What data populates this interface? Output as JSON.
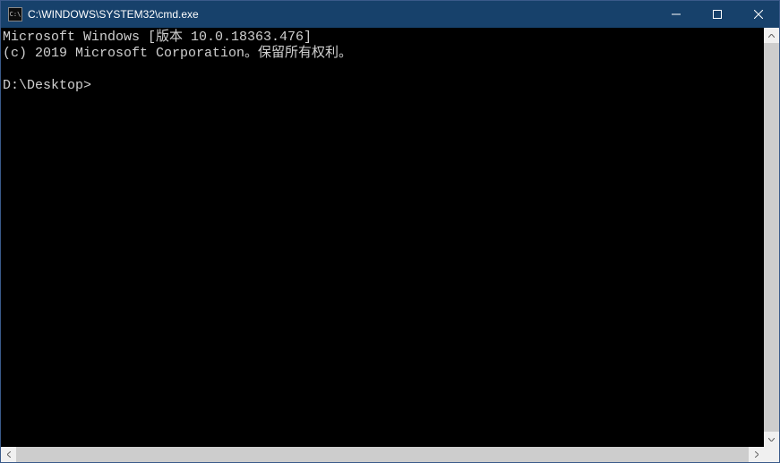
{
  "titlebar": {
    "title": "C:\\WINDOWS\\SYSTEM32\\cmd.exe",
    "icon_label": "C:\\"
  },
  "terminal": {
    "line1": "Microsoft Windows [版本 10.0.18363.476]",
    "line2": "(c) 2019 Microsoft Corporation。保留所有权利。",
    "blank": "",
    "prompt": "D:\\Desktop>"
  }
}
